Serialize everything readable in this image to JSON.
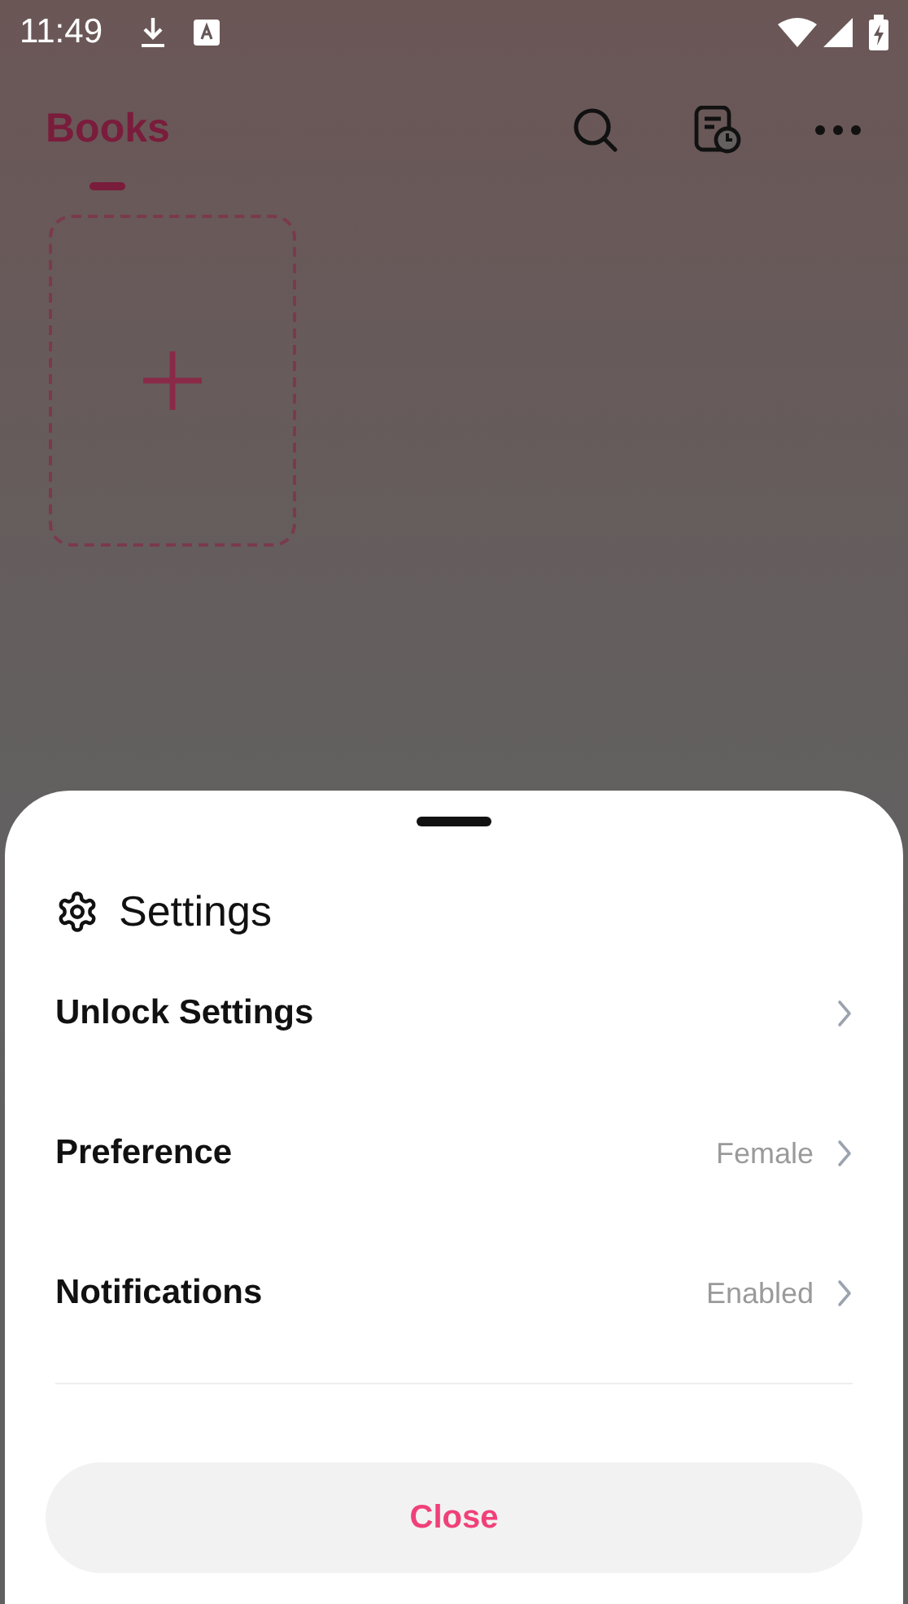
{
  "status_bar": {
    "time": "11:49"
  },
  "tabs": [
    {
      "label": "Books",
      "selected": true
    }
  ],
  "sheet": {
    "title": "Settings",
    "items": [
      {
        "label": "Unlock Settings"
      },
      {
        "label": "Preference",
        "value": "Female"
      },
      {
        "label": "Notifications",
        "value": "Enabled"
      }
    ],
    "close_button": "Close"
  }
}
